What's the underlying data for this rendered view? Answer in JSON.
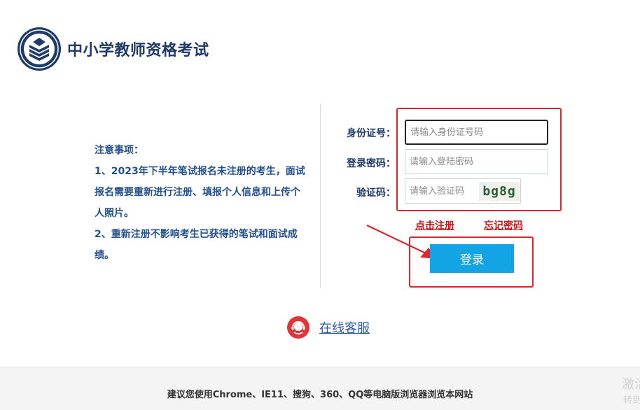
{
  "header": {
    "title": "中小学教师资格考试",
    "logo_icon": "book-emblem-icon"
  },
  "notice": {
    "heading": "注意事项：",
    "line1": "1、2023年下半年笔试报名未注册的考生，面试报名需要重新进行注册、填报个人信息和上传个人照片。",
    "line2": "2、重新注册不影响考生已获得的笔试和面试成绩。"
  },
  "form": {
    "id_label": "身份证号：",
    "id_placeholder": "请输入身份证号码",
    "id_value": "",
    "pwd_label": "登录密码：",
    "pwd_placeholder": "请输入登陆密码",
    "pwd_value": "",
    "captcha_label": "验证码：",
    "captcha_placeholder": "请输入验证码",
    "captcha_value": "",
    "captcha_text": "bg8g",
    "register_link": "点击注册",
    "forgot_link": "忘记密码",
    "login_button": "登录"
  },
  "support": {
    "label": "在线客服",
    "icon": "customer-service-icon"
  },
  "footer": {
    "text": "建议您使用Chrome、IE11、搜狗、360、QQ等电脑版浏览器浏览本网站",
    "watermark_1": "激活",
    "watermark_2": "转到"
  },
  "colors": {
    "brand_blue": "#1e3a68",
    "button_blue": "#13a4e6",
    "alert_red": "#e0262b",
    "link_red": "#c9161c",
    "support_blue": "#2c5aa8"
  }
}
